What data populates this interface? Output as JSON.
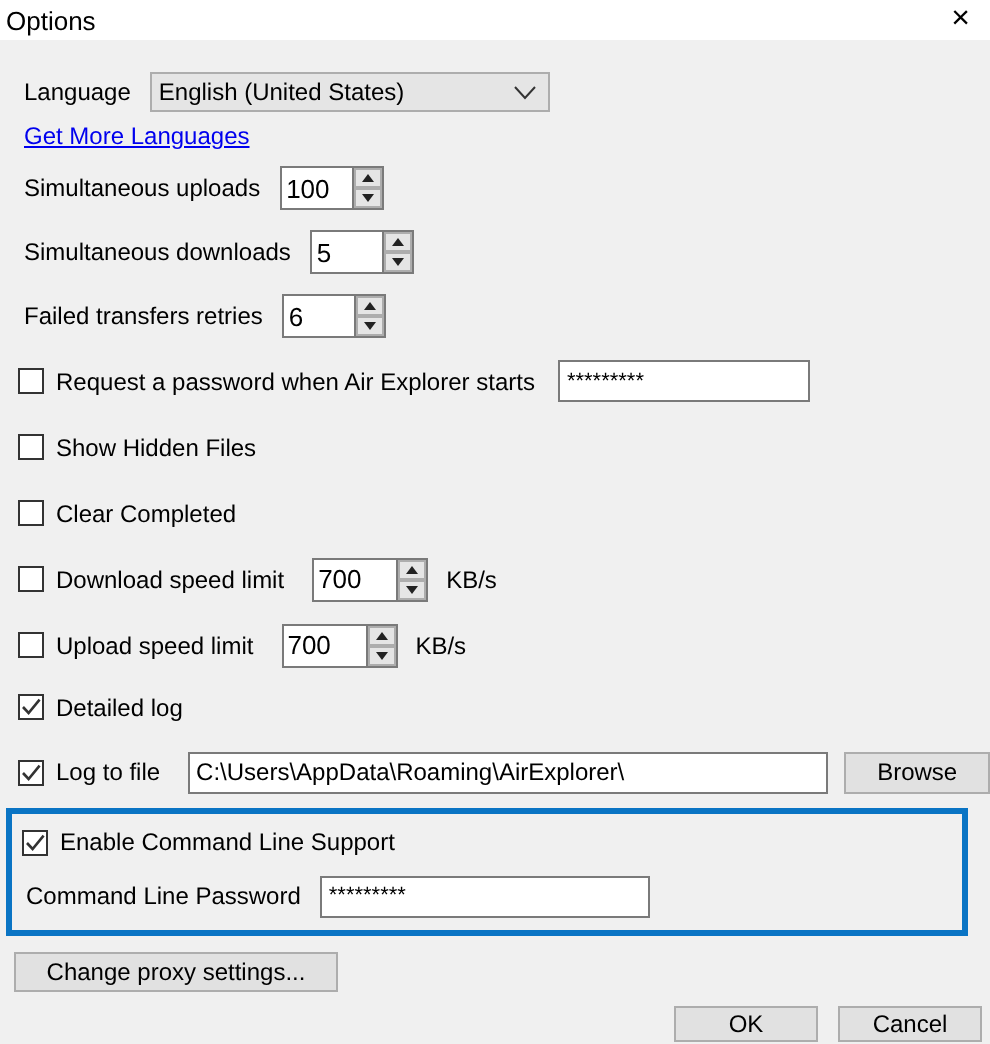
{
  "window": {
    "title": "Options",
    "close": "×"
  },
  "rows": [
    {
      "kind": "select",
      "label": "Language",
      "value": "English (United States)"
    },
    {
      "kind": "link",
      "label": "Get More Languages"
    },
    {
      "kind": "spin",
      "label": "Simultaneous uploads",
      "value": "100"
    },
    {
      "kind": "spin",
      "label": "Simultaneous downloads",
      "value": "5"
    },
    {
      "kind": "spin",
      "label": "Failed transfers retries",
      "value": "6"
    },
    {
      "kind": "check",
      "label": "Request a password when Air Explorer starts",
      "checked": false,
      "password": "*********"
    },
    {
      "kind": "check",
      "label": "Show Hidden Files",
      "checked": false
    },
    {
      "kind": "check",
      "label": "Clear Completed",
      "checked": false
    },
    {
      "kind": "check",
      "label": "Download speed limit",
      "checked": false,
      "spin": "700",
      "unit": "KB/s"
    },
    {
      "kind": "check",
      "label": "Upload speed limit",
      "checked": false,
      "spin": "700",
      "unit": "KB/s"
    },
    {
      "kind": "check",
      "label": "Detailed log",
      "checked": true
    },
    {
      "kind": "check",
      "label": "Log to file",
      "checked": true,
      "path": "C:\\Users\\AppData\\Roaming\\AirExplorer\\",
      "button": "Browse"
    }
  ],
  "command_line": {
    "label": "Enable Command Line Support",
    "checked": true,
    "password_label": "Command Line Password",
    "password": "*********"
  },
  "proxy_button": "Change proxy settings...",
  "buttons": [
    "OK",
    "Cancel"
  ]
}
